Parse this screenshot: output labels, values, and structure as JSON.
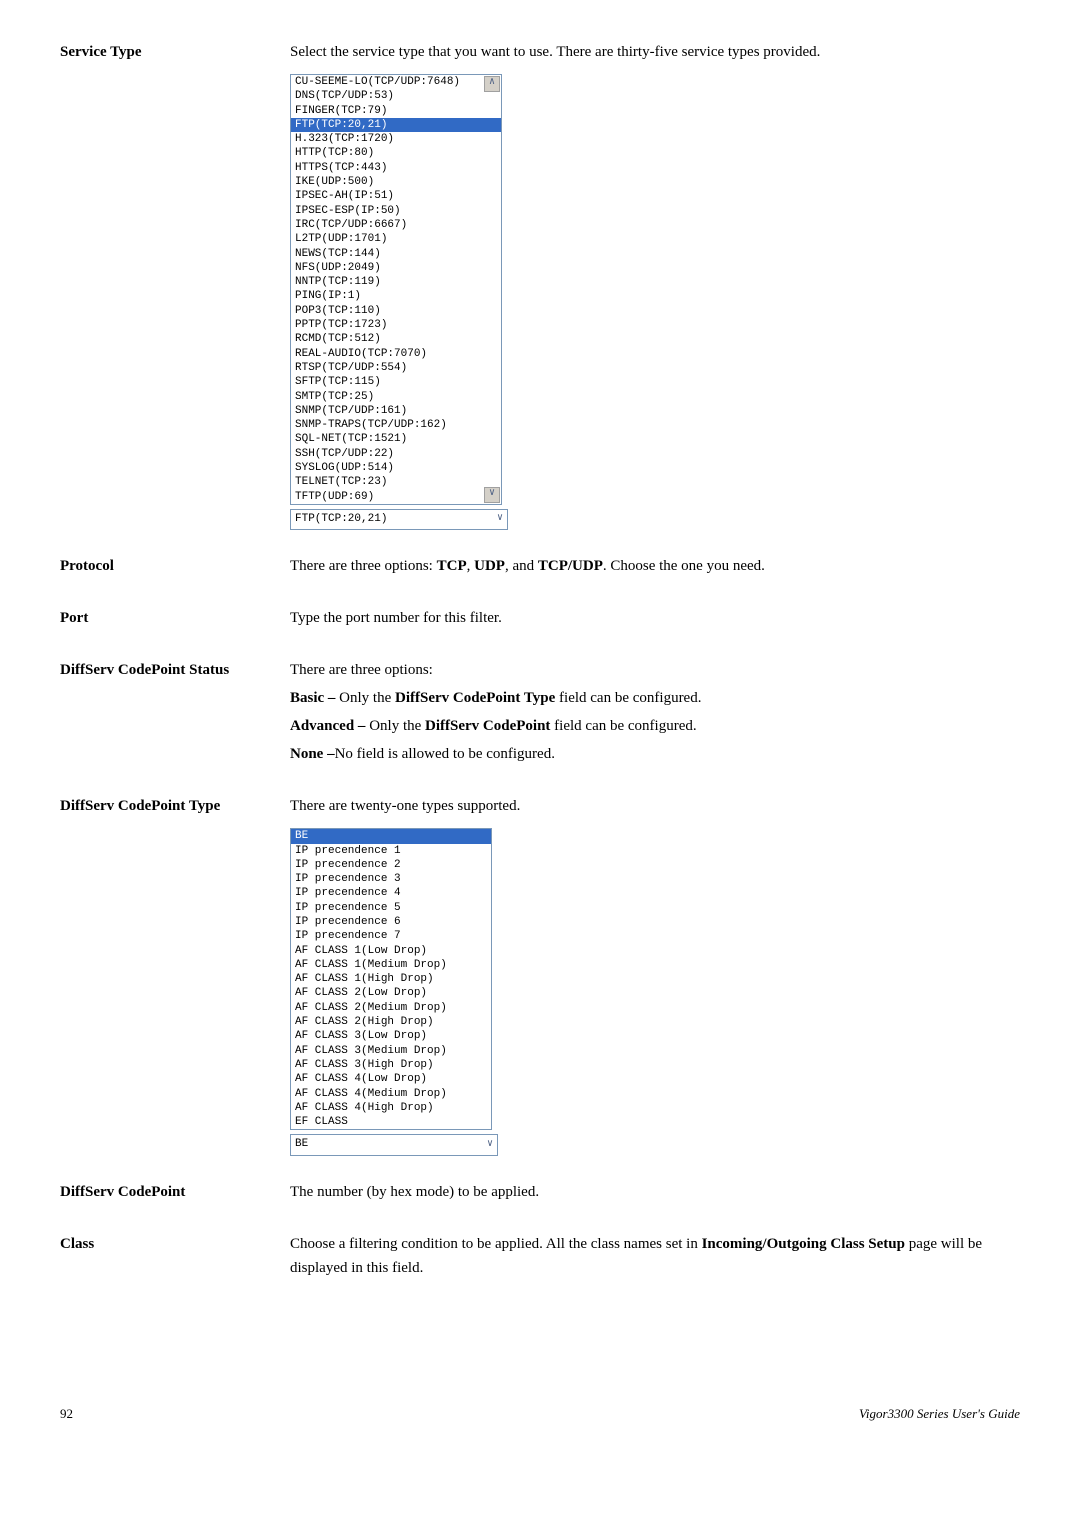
{
  "rows": {
    "serviceType": {
      "label": "Service Type",
      "desc": "Select the service type that you want to use. There are thirty-five service types provided.",
      "listItems": [
        "CU-SEEME-LO(TCP/UDP:7648)",
        "DNS(TCP/UDP:53)",
        "FINGER(TCP:79)",
        "FTP(TCP:20,21)",
        "H.323(TCP:1720)",
        "HTTP(TCP:80)",
        "HTTPS(TCP:443)",
        "IKE(UDP:500)",
        "IPSEC-AH(IP:51)",
        "IPSEC-ESP(IP:50)",
        "IRC(TCP/UDP:6667)",
        "L2TP(UDP:1701)",
        "NEWS(TCP:144)",
        "NFS(UDP:2049)",
        "NNTP(TCP:119)",
        "PING(IP:1)",
        "POP3(TCP:110)",
        "PPTP(TCP:1723)",
        "RCMD(TCP:512)",
        "REAL-AUDIO(TCP:7070)",
        "RTSP(TCP/UDP:554)",
        "SFTP(TCP:115)",
        "SMTP(TCP:25)",
        "SNMP(TCP/UDP:161)",
        "SNMP-TRAPS(TCP/UDP:162)",
        "SQL-NET(TCP:1521)",
        "SSH(TCP/UDP:22)",
        "SYSLOG(UDP:514)",
        "TELNET(TCP:23)",
        "TFTP(UDP:69)"
      ],
      "selectedIndex": 3,
      "dropdownValue": "FTP(TCP:20,21)"
    },
    "protocol": {
      "label": "Protocol",
      "desc_pre": "There are three options: ",
      "b1": "TCP",
      "sep1": ", ",
      "b2": "UDP",
      "sep2": ", and ",
      "b3": "TCP/UDP",
      "desc_post": ". Choose the one you need."
    },
    "port": {
      "label": "Port",
      "desc": "Type the port number for this filter."
    },
    "dscpStatus": {
      "label": "DiffServ CodePoint Status",
      "line1": "There are three options:",
      "basic_b": "Basic – ",
      "basic_t1": "Only the ",
      "basic_b2": "DiffServ CodePoint Type",
      "basic_t2": " field can be configured.",
      "adv_b": "Advanced – ",
      "adv_t1": "Only the ",
      "adv_b2": "DiffServ CodePoint",
      "adv_t2": " field can be configured.",
      "none_b": "None –",
      "none_t": "No field is allowed to be configured."
    },
    "dscpType": {
      "label": "DiffServ CodePoint Type",
      "desc": "There are twenty-one types supported.",
      "listItems": [
        "BE",
        "IP precendence 1",
        "IP precendence 2",
        "IP precendence 3",
        "IP precendence 4",
        "IP precendence 5",
        "IP precendence 6",
        "IP precendence 7",
        "AF CLASS 1(Low Drop)",
        "AF CLASS 1(Medium Drop)",
        "AF CLASS 1(High Drop)",
        "AF CLASS 2(Low Drop)",
        "AF CLASS 2(Medium Drop)",
        "AF CLASS 2(High Drop)",
        "AF CLASS 3(Low Drop)",
        "AF CLASS 3(Medium Drop)",
        "AF CLASS 3(High Drop)",
        "AF CLASS 4(Low Drop)",
        "AF CLASS 4(Medium Drop)",
        "AF CLASS 4(High Drop)",
        "EF CLASS"
      ],
      "selectedIndex": 0,
      "dropdownValue": "BE"
    },
    "dscp": {
      "label": "DiffServ CodePoint",
      "desc": "The number (by hex mode) to be applied."
    },
    "class": {
      "label": "Class",
      "desc_t1": "Choose a filtering condition to be applied. All the class names set in ",
      "desc_b": "Incoming/Outgoing Class Setup",
      "desc_t2": " page will be displayed in this field."
    }
  },
  "footer": {
    "pageNum": "92",
    "guideTitle": "Vigor3300 Series User's Guide"
  }
}
